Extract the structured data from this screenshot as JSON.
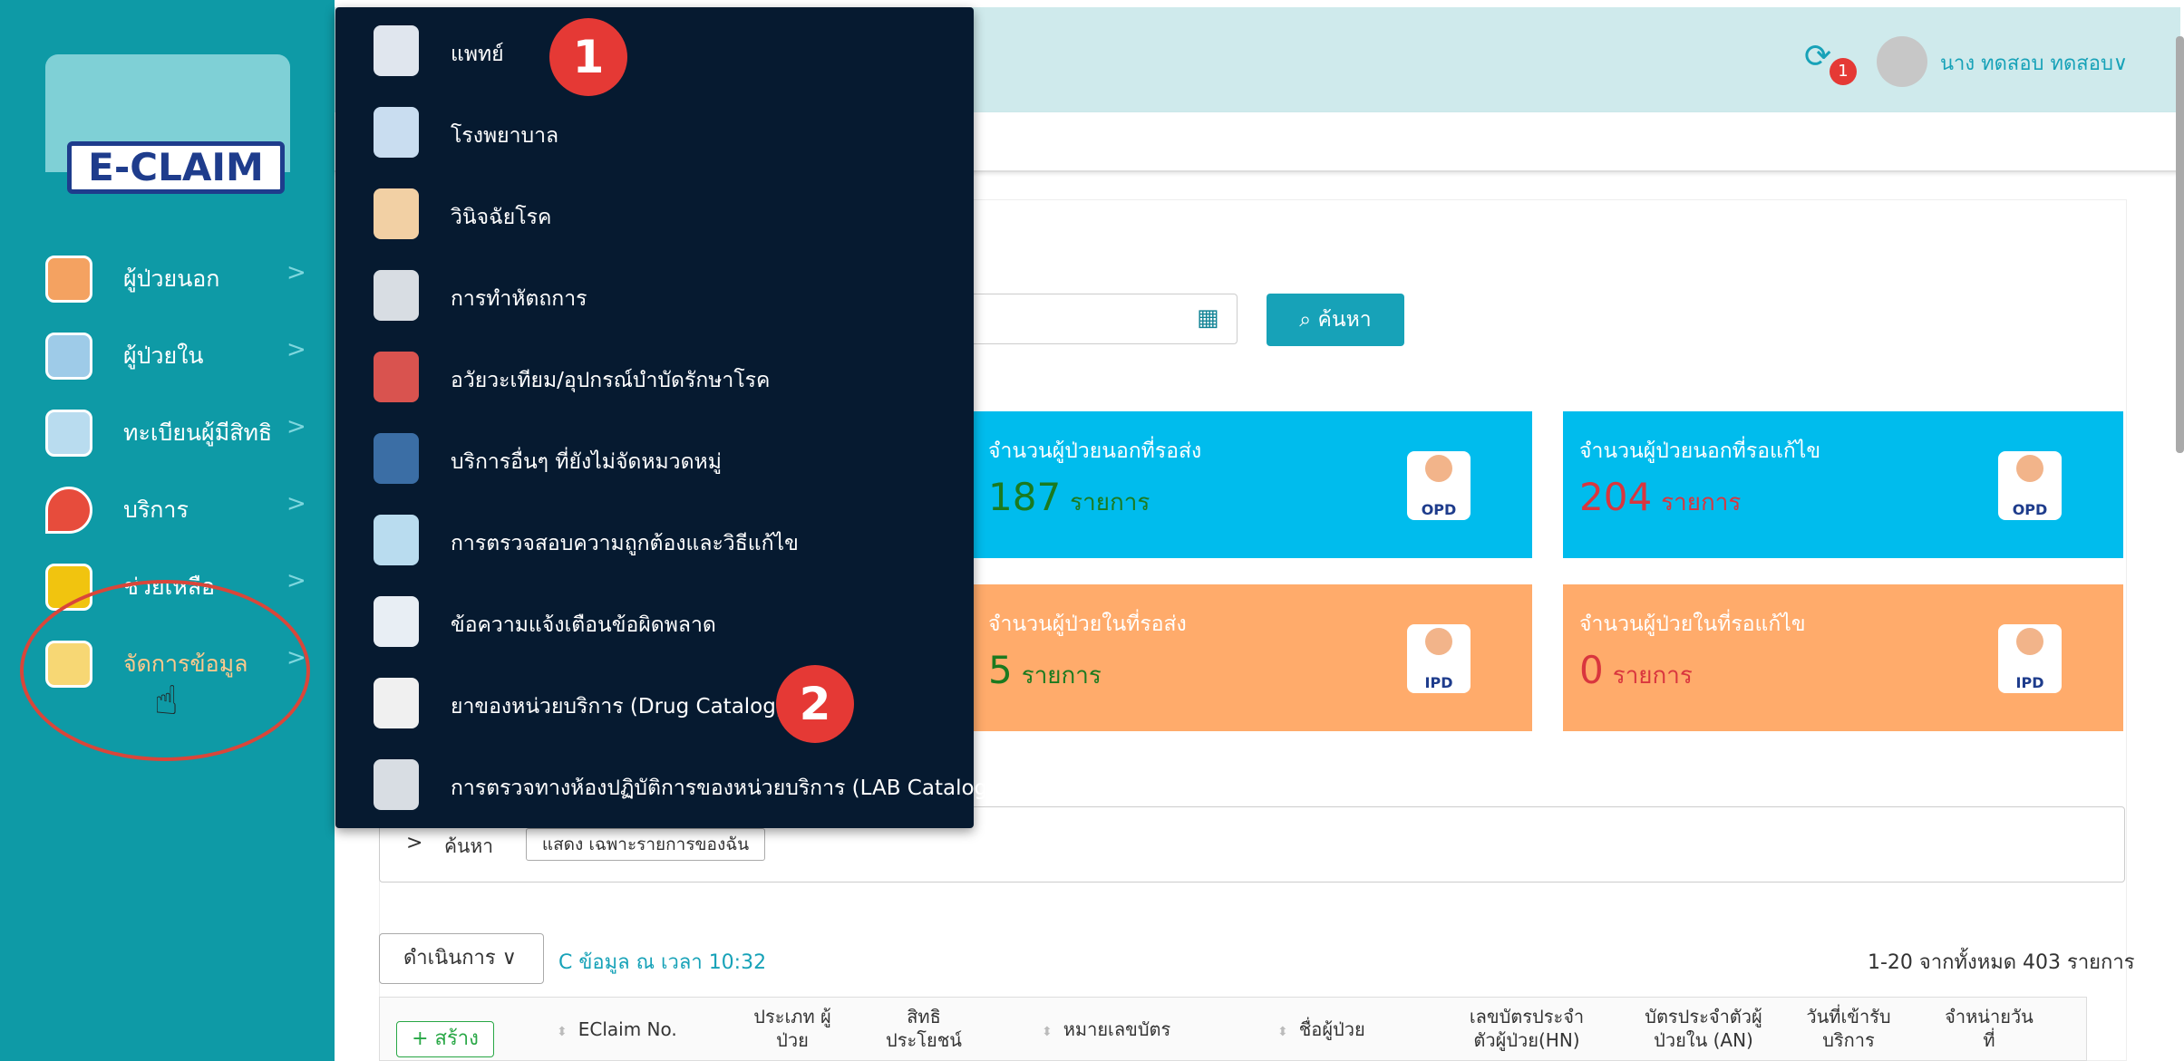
{
  "app": {
    "logo_text": "E-CLAIM"
  },
  "sidebar": {
    "items": [
      {
        "label": "ผู้ป่วยนอก",
        "icon": "opd-patient-icon"
      },
      {
        "label": "ผู้ป่วยใน",
        "icon": "ipd-patient-icon"
      },
      {
        "label": "ทะเบียนผู้มีสิทธิ",
        "icon": "registry-icon"
      },
      {
        "label": "บริการ",
        "icon": "service-pin-icon"
      },
      {
        "label": "ช่วยเหลือ",
        "icon": "help-icon"
      },
      {
        "label": "จัดการข้อมูล",
        "icon": "data-management-icon"
      }
    ],
    "chevron": ">"
  },
  "header": {
    "notification_count": "1",
    "user_name": "นาง ทดสอบ ทดสอบ∨"
  },
  "dropdown": {
    "items": [
      {
        "label": "แพทย์",
        "icon": "doctor-icon"
      },
      {
        "label": "โรงพยาบาล",
        "icon": "hospital-icon"
      },
      {
        "label": "วินิจฉัยโรค",
        "icon": "diagnosis-icon"
      },
      {
        "label": "การทำหัตถการ",
        "icon": "surgery-tools-icon"
      },
      {
        "label": "อวัยวะเทียม/อุปกรณ์บำบัดรักษาโรค",
        "icon": "prosthesis-icon"
      },
      {
        "label": "บริการอื่นๆ ที่ยังไม่จัดหมวดหมู่",
        "icon": "headset-icon"
      },
      {
        "label": "การตรวจสอบความถูกต้องและวิธีแก้ไข",
        "icon": "validation-icon"
      },
      {
        "label": "ข้อความแจ้งเตือนข้อผิดพลาด",
        "icon": "error-alert-icon"
      },
      {
        "label": "ยาของหน่วยบริการ (Drug Catalog)",
        "icon": "drug-icon"
      },
      {
        "label": "การตรวจทางห้องปฏิบัติการของหน่วยบริการ (LAB Catalog)",
        "icon": "microscope-icon"
      }
    ],
    "step_badges": [
      "1",
      "2"
    ]
  },
  "search": {
    "button_label": "ค้นหา",
    "date_value": ""
  },
  "stats": [
    {
      "title": "จำนวนผู้ป่วยนอกที่รอส่ง",
      "value": "187",
      "unit": "รายการ",
      "tag": "OPD"
    },
    {
      "title": "จำนวนผู้ป่วยนอกที่รอแก้ไข",
      "value": "204",
      "unit": "รายการ",
      "tag": "OPD"
    },
    {
      "title": "จำนวนผู้ป่วยในที่รอส่ง",
      "value": "5",
      "unit": "รายการ",
      "tag": "IPD"
    },
    {
      "title": "จำนวนผู้ป่วยในที่รอแก้ไข",
      "value": "0",
      "unit": "รายการ",
      "tag": "IPD"
    }
  ],
  "filter": {
    "chevron": ">",
    "label": "ค้นหา",
    "chip": "แสดง เฉพาะรายการของฉัน"
  },
  "toolbar": {
    "action_label": "ดำเนินการ ∨",
    "data_time": "C ข้อมูล ณ เวลา 10:32",
    "pagination": "1-20 จากทั้งหมด 403 รายการ"
  },
  "table": {
    "create_label": "+ สร้าง",
    "columns": [
      "EClaim No.",
      "ประเภท ผู้ป่วย",
      "สิทธิ ประโยชน์",
      "หมายเลขบัตร",
      "ชื่อผู้ป่วย",
      "เลขบัตรประจำ ตัวผู้ป่วย(HN)",
      "บัตรประจำตัวผู้ ป่วยใน (AN)",
      "วันที่เข้ารับ บริการ",
      "จำหน่ายวัน ที่"
    ]
  }
}
